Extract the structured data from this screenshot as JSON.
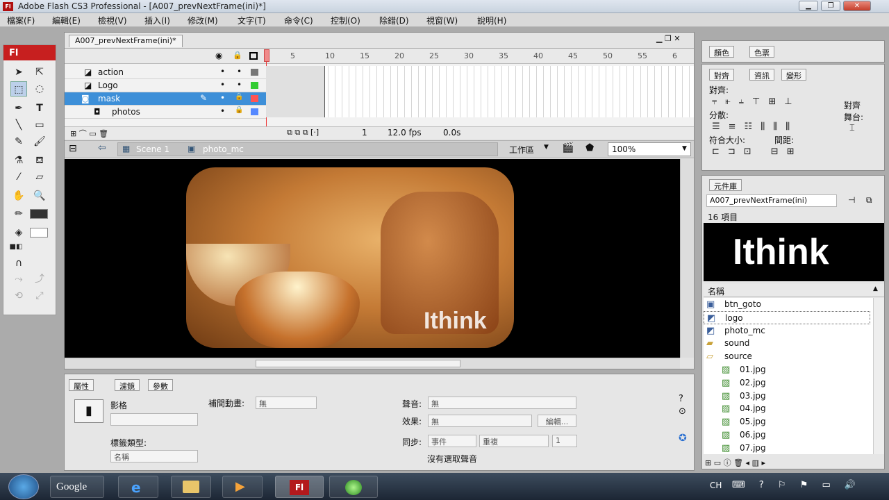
{
  "window": {
    "title": "Adobe Flash CS3 Professional - [A007_prevNextFrame(ini)*]"
  },
  "menu": [
    "檔案(F)",
    "編輯(E)",
    "檢視(V)",
    "插入(I)",
    "修改(M)",
    "文字(T)",
    "命令(C)",
    "控制(O)",
    "除錯(D)",
    "視窗(W)",
    "說明(H)"
  ],
  "toolbox": {
    "brand": "Fl"
  },
  "document": {
    "tab": "A007_prevNextFrame(ini)*"
  },
  "timeline": {
    "frame_numbers": [
      "5",
      "10",
      "15",
      "20",
      "25",
      "30",
      "35",
      "40",
      "45",
      "50",
      "55",
      "6"
    ],
    "layers": [
      {
        "name": "action"
      },
      {
        "name": "Logo"
      },
      {
        "name": "mask"
      },
      {
        "name": "photos"
      }
    ],
    "status": {
      "frame": "1",
      "fps": "12.0 fps",
      "time": "0.0s"
    }
  },
  "editbar": {
    "scene": "Scene 1",
    "symbol": "photo_mc",
    "workspace": "工作區",
    "zoom": "100%"
  },
  "stage": {
    "watermark": "Ithink"
  },
  "properties": {
    "tabs": [
      "屬性",
      "濾鏡",
      "參數"
    ],
    "type": "影格",
    "tween_label": "補間動畫:",
    "tween_value": "無",
    "sound_label": "聲音:",
    "sound_value": "無",
    "effect_label": "效果:",
    "effect_value": "無",
    "edit_btn": "編輯...",
    "sync_label": "同步:",
    "sync_value": "事件",
    "repeat_value": "重複",
    "repeat_count": "1",
    "label_type_label": "標籤類型:",
    "label_type_value": "名稱",
    "no_sound": "沒有選取聲音"
  },
  "color_panel": {
    "tabs": [
      "顏色",
      "色票"
    ]
  },
  "align_panel": {
    "tabs": [
      "對齊",
      "資訊",
      "變形"
    ],
    "align": "對齊:",
    "distribute": "分散:",
    "match_size": "符合大小:",
    "spacing": "間距:",
    "to_stage": "對齊\n舞台:"
  },
  "library": {
    "tab": "元件庫",
    "doc": "A007_prevNextFrame(ini)",
    "count": "16 項目",
    "preview_text": "Ithink",
    "col_name": "名稱",
    "items": [
      {
        "name": "btn_goto",
        "kind": "button"
      },
      {
        "name": "logo",
        "kind": "mc"
      },
      {
        "name": "photo_mc",
        "kind": "mc"
      },
      {
        "name": "sound",
        "kind": "folder"
      },
      {
        "name": "source",
        "kind": "folder-open"
      },
      {
        "name": "01.jpg",
        "kind": "bitmap"
      },
      {
        "name": "02.jpg",
        "kind": "bitmap"
      },
      {
        "name": "03.jpg",
        "kind": "bitmap"
      },
      {
        "name": "04.jpg",
        "kind": "bitmap"
      },
      {
        "name": "05.jpg",
        "kind": "bitmap"
      },
      {
        "name": "06.jpg",
        "kind": "bitmap"
      },
      {
        "name": "07.jpg",
        "kind": "bitmap"
      }
    ]
  },
  "taskbar": {
    "google": "Google",
    "flash": "Fl",
    "lang": "CH"
  }
}
